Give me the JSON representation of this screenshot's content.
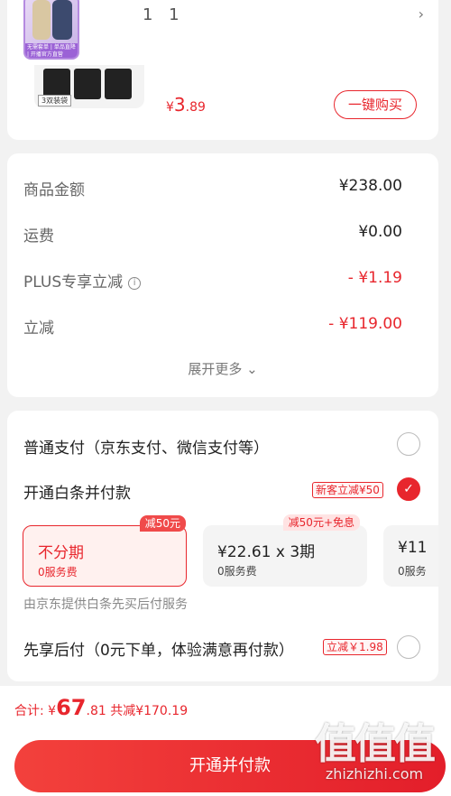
{
  "top_product": {
    "number": "1 1",
    "thumb_strip": "无需套单 | 单品直降 | 开播官方直营",
    "pack_label": "3双装袋",
    "price_symbol": "¥",
    "price_int": "3",
    "price_dec": ".89",
    "buy_label": "一键购买"
  },
  "price_rows": [
    {
      "label": "商品金额",
      "value": "¥238.00"
    },
    {
      "label": "运费",
      "value": "¥0.00"
    },
    {
      "label": "PLUS专享立减",
      "value": "- ¥1.19"
    },
    {
      "label": "立减",
      "value": "- ¥119.00"
    }
  ],
  "expand_more": "展开更多 ⌄",
  "payment": {
    "option_normal": "普通支付（京东支付、微信支付等）",
    "option_baitiao": "开通白条并付款",
    "baitiao_tag": "新客立减¥50",
    "plans": [
      {
        "title": "不分期",
        "sub": "0服务费",
        "badge": "减50元"
      },
      {
        "title": "¥22.61 x 3期",
        "sub": "0服务费",
        "badge": "减50元+免息"
      },
      {
        "title": "¥11",
        "sub": "0服务"
      }
    ],
    "note": "由京东提供白条先买后付服务",
    "option_later": "先享后付（0元下单，体验满意再付款）",
    "later_tag": "立减￥1.98"
  },
  "total": {
    "label": "合计: ",
    "symbol": "¥",
    "int": "67",
    "dec": ".81",
    "saved": " 共减¥170.19"
  },
  "cta_label": "开通并付款",
  "watermark": {
    "logo": "值值值",
    "site": "zhizhizhi.com"
  }
}
